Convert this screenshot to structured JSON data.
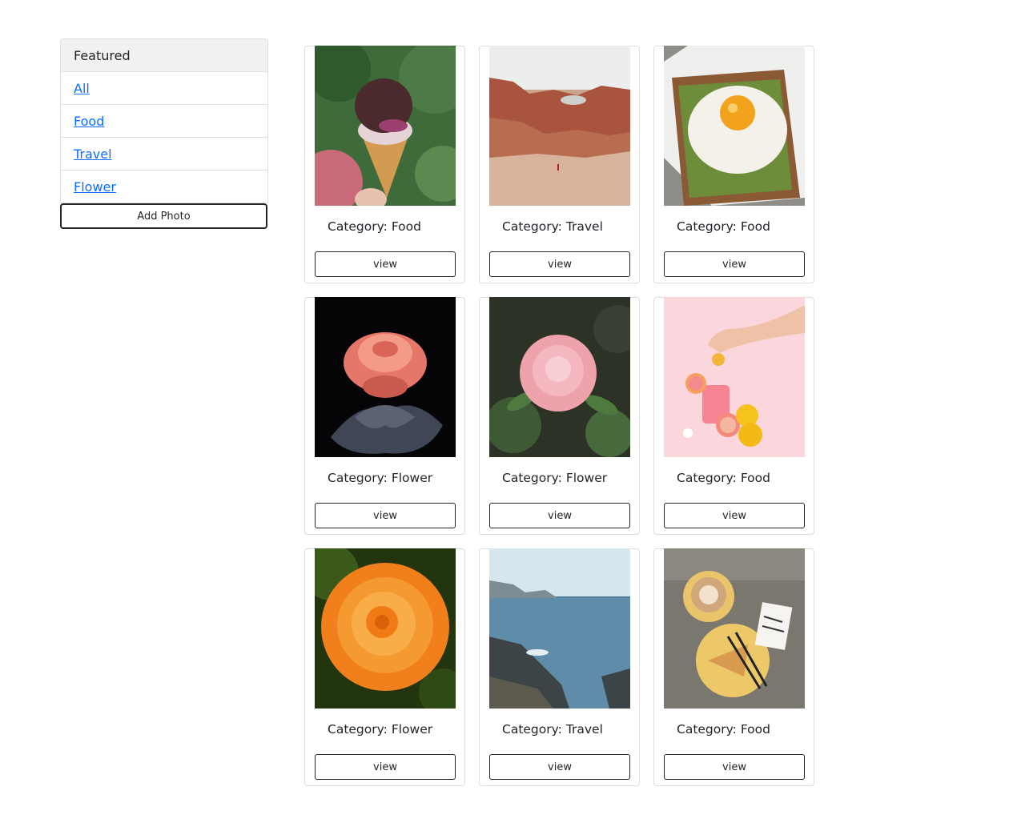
{
  "sidebar": {
    "header": "Featured",
    "items": [
      {
        "label": "All"
      },
      {
        "label": "Food"
      },
      {
        "label": "Travel"
      },
      {
        "label": "Flower"
      }
    ],
    "add_label": "Add Photo"
  },
  "cards": [
    {
      "caption": "Category: Food",
      "button": "view",
      "image": "ice-cream-cone"
    },
    {
      "caption": "Category: Travel",
      "button": "view",
      "image": "red-rock-canyon"
    },
    {
      "caption": "Category: Food",
      "button": "view",
      "image": "egg-toast"
    },
    {
      "caption": "Category: Flower",
      "button": "view",
      "image": "coral-rose-dark"
    },
    {
      "caption": "Category: Flower",
      "button": "view",
      "image": "pink-rose-garden"
    },
    {
      "caption": "Category: Food",
      "button": "view",
      "image": "grapefruit-drink"
    },
    {
      "caption": "Category: Flower",
      "button": "view",
      "image": "orange-rose"
    },
    {
      "caption": "Category: Travel",
      "button": "view",
      "image": "rocky-coastline"
    },
    {
      "caption": "Category: Food",
      "button": "view",
      "image": "coffee-and-pie"
    }
  ],
  "colors": {
    "link": "#0d6efd",
    "border": "#dfdfdf",
    "header_bg": "#f1f1f1"
  }
}
